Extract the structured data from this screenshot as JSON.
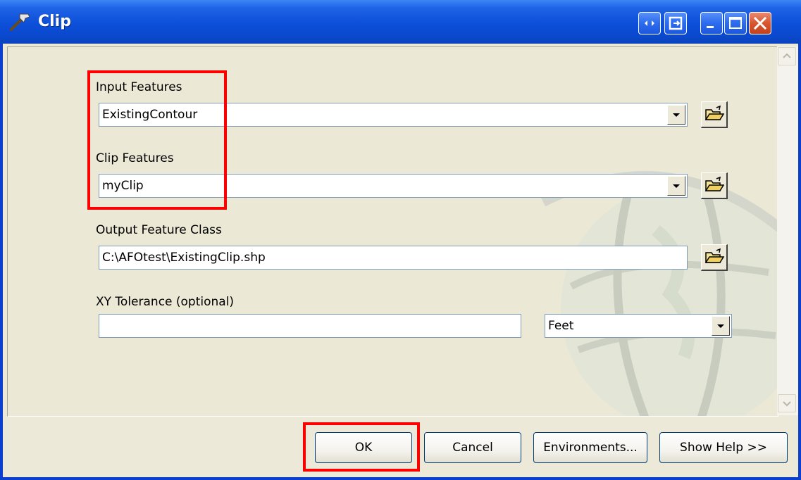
{
  "window": {
    "title": "Clip",
    "title_icon": "hammer-icon",
    "controls": [
      "context-help-icon",
      "restore-tool-icon",
      "minimize-icon",
      "maximize-icon",
      "close-icon"
    ]
  },
  "form": {
    "input_features": {
      "label": "Input Features",
      "value": "ExistingContour"
    },
    "clip_features": {
      "label": "Clip Features",
      "value": "myClip"
    },
    "output_feature_class": {
      "label": "Output Feature Class",
      "value": "C:\\AFOtest\\ExistingClip.shp"
    },
    "xy_tolerance": {
      "label": "XY Tolerance (optional)",
      "value": "",
      "unit": "Feet"
    }
  },
  "buttons": {
    "ok": "OK",
    "cancel": "Cancel",
    "environments": "Environments...",
    "show_help": "Show Help >>"
  },
  "colors": {
    "titlebar": "#0a49cf",
    "highlight": "#ff0000",
    "dialog_bg": "#ece9d8"
  }
}
